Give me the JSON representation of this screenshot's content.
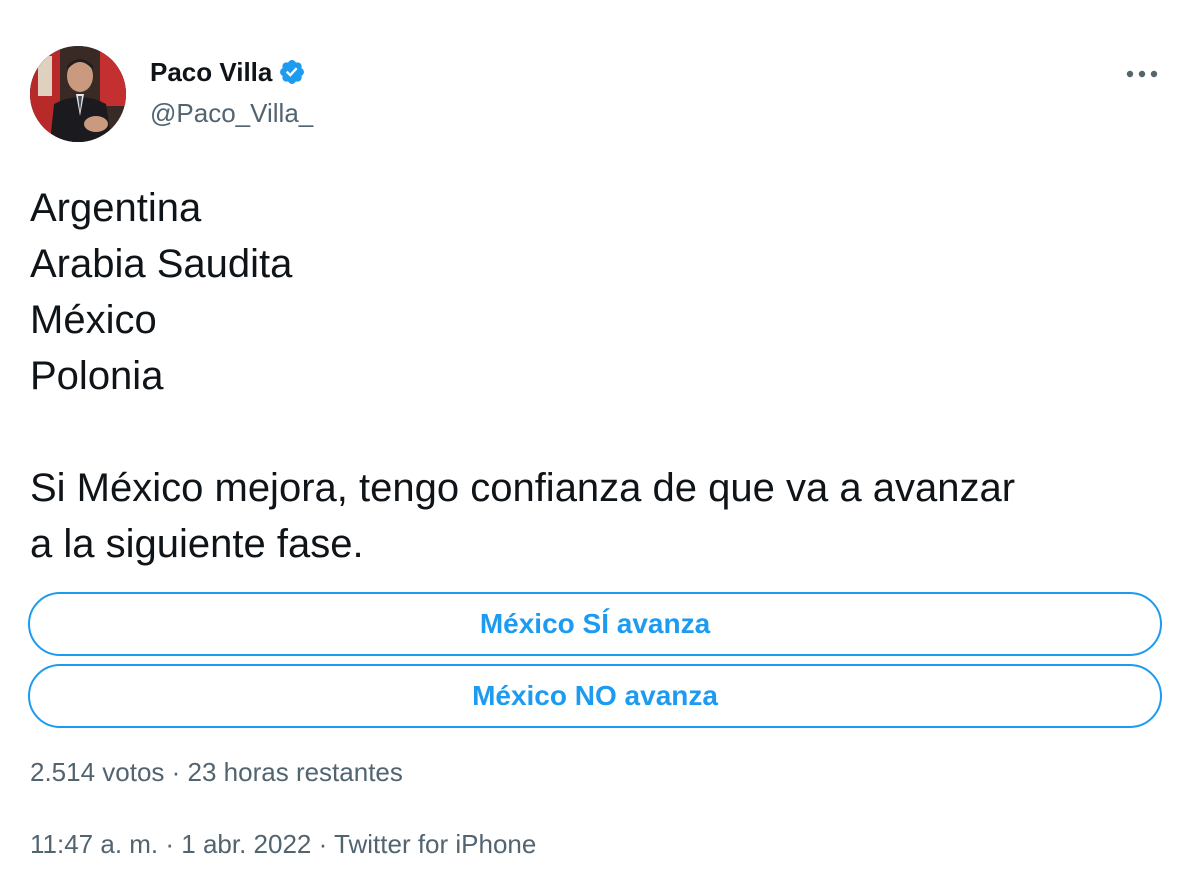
{
  "author": {
    "display_name": "Paco Villa",
    "handle": "@Paco_Villa_",
    "verified": true,
    "verified_icon": "verified-badge-icon",
    "avatar_icon": "profile-photo"
  },
  "more_icon": "more-horizontal-icon",
  "tweet": {
    "lines": [
      "Argentina",
      "Arabia Saudita",
      "México",
      "Polonia"
    ],
    "paragraph_line_1": "Si México mejora, tengo confianza de que va a avanzar",
    "paragraph_line_2": "a la siguiente fase."
  },
  "poll": {
    "options": [
      {
        "label": "México SÍ avanza"
      },
      {
        "label": "México NO avanza"
      }
    ],
    "meta": "2.514 votos · 23 horas restantes"
  },
  "footer": {
    "time": "11:47 a. m.",
    "separator": " · ",
    "date": "1 abr. 2022",
    "source": "Twitter for iPhone"
  },
  "colors": {
    "accent": "#1d9bf0",
    "text_primary": "#0f1419",
    "text_secondary": "#536471"
  }
}
